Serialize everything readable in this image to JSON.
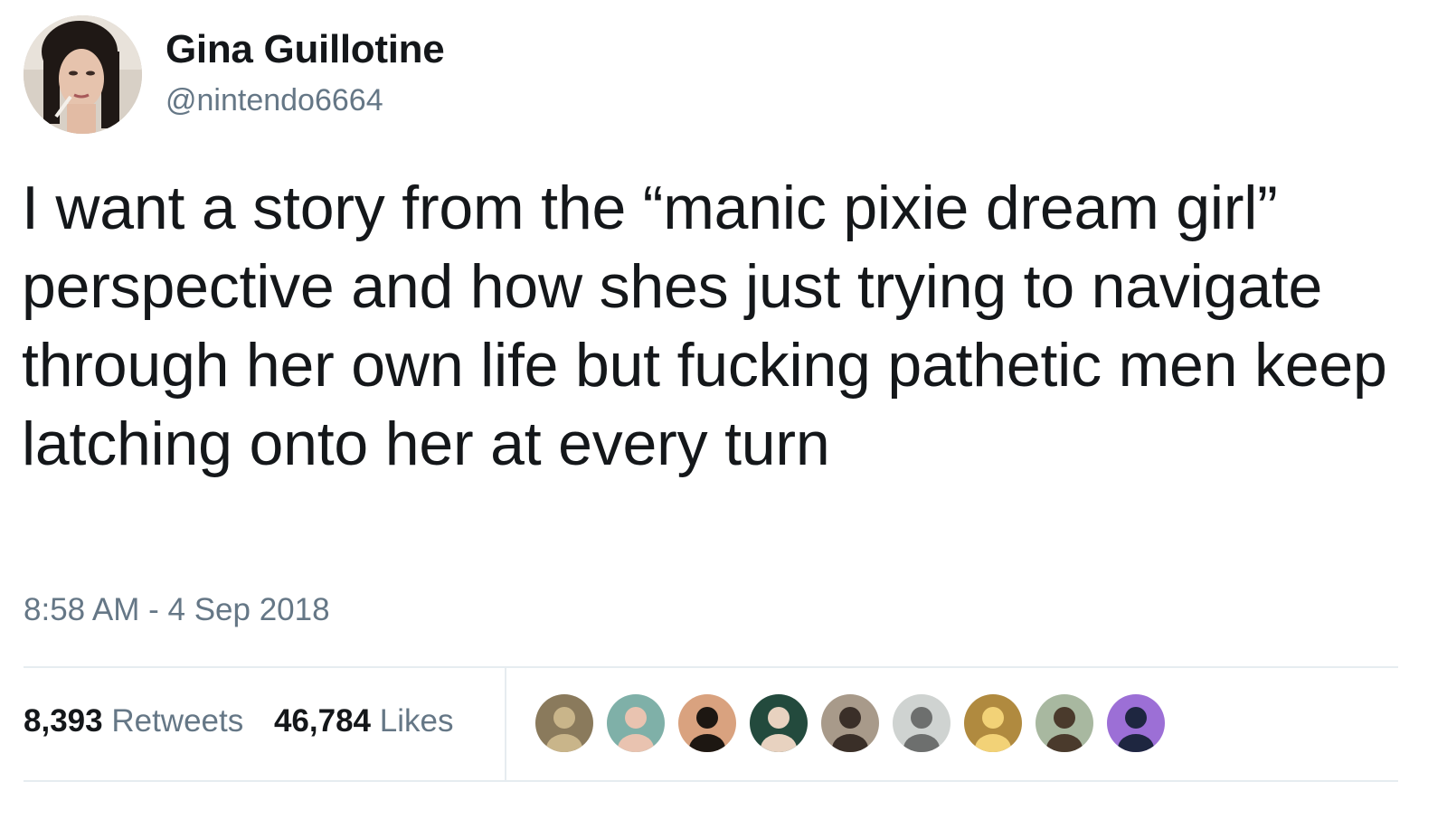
{
  "user": {
    "display_name": "Gina Guillotine",
    "handle": "@nintendo6664"
  },
  "tweet": {
    "text": "I want a story from the “manic pixie dream girl” perspective and how shes just trying to navigate through her own life but fucking pathetic men keep latching onto her at every turn",
    "timestamp": "8:58 AM - 4 Sep 2018"
  },
  "stats": {
    "retweets_count": "8,393",
    "retweets_label": "Retweets",
    "likes_count": "46,784",
    "likes_label": "Likes"
  },
  "likers": [
    {
      "name": "liker-avatar-1",
      "bg": "#8a7a5c",
      "fg": "#c9b58a"
    },
    {
      "name": "liker-avatar-2",
      "bg": "#7fb0a8",
      "fg": "#e9c3b0"
    },
    {
      "name": "liker-avatar-3",
      "bg": "#d9a27f",
      "fg": "#1d1712"
    },
    {
      "name": "liker-avatar-4",
      "bg": "#234a3d",
      "fg": "#e8d2c0"
    },
    {
      "name": "liker-avatar-5",
      "bg": "#a89a8a",
      "fg": "#3a2f28"
    },
    {
      "name": "liker-avatar-6",
      "bg": "#cfd3d1",
      "fg": "#6d6f6e"
    },
    {
      "name": "liker-avatar-7",
      "bg": "#b08a3f",
      "fg": "#f2d277"
    },
    {
      "name": "liker-avatar-8",
      "bg": "#a8b8a0",
      "fg": "#4a3a2c"
    },
    {
      "name": "liker-avatar-9",
      "bg": "#9c6fd6",
      "fg": "#1e2640"
    }
  ],
  "colors": {
    "primary_text": "#14171a",
    "secondary_text": "#657786",
    "divider": "#e6ecf0"
  }
}
